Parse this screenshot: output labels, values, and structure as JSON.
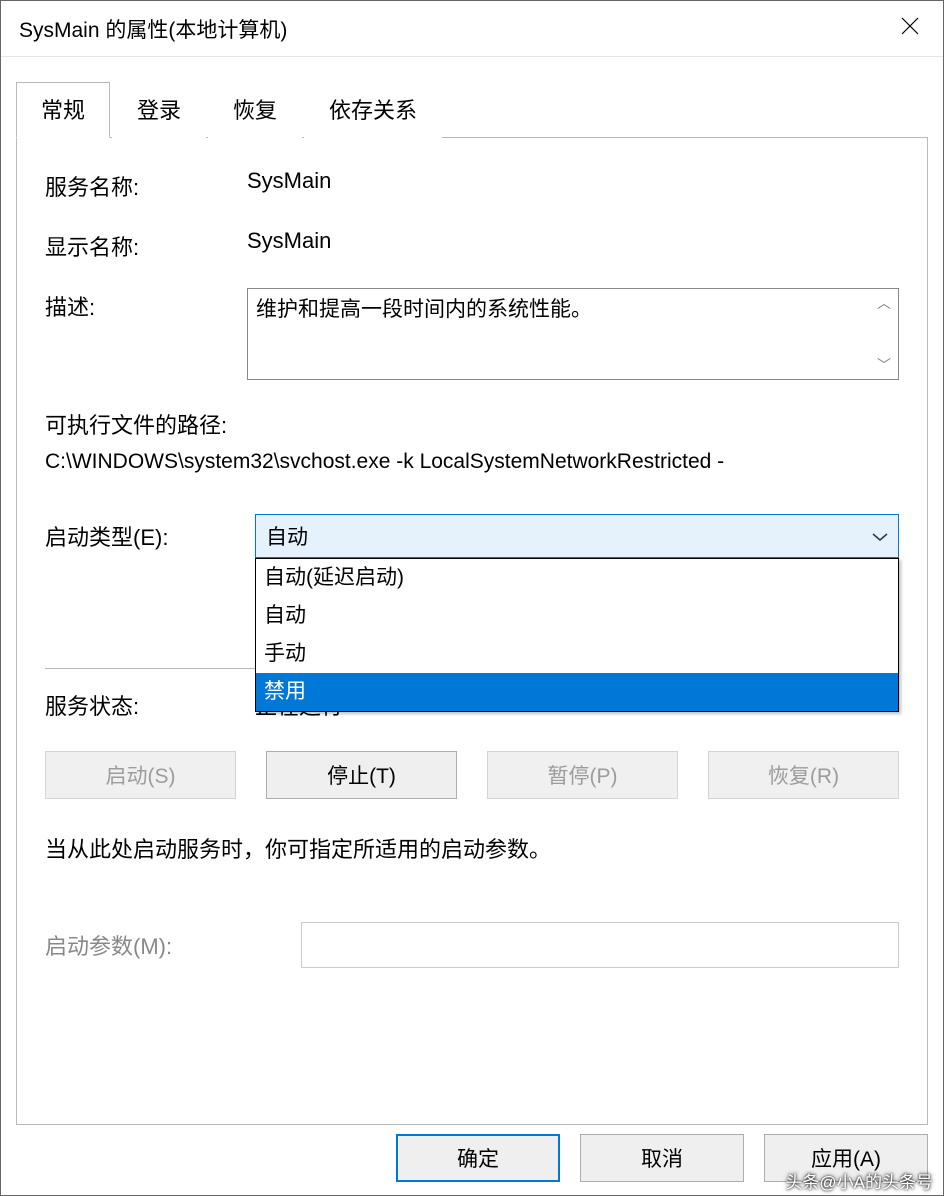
{
  "title": "SysMain 的属性(本地计算机)",
  "tabs": {
    "general": "常规",
    "logon": "登录",
    "recovery": "恢复",
    "dependencies": "依存关系"
  },
  "labels": {
    "service_name": "服务名称:",
    "display_name": "显示名称:",
    "description": "描述:",
    "exe_label": "可执行文件的路径:",
    "startup_type": "启动类型(E):",
    "service_status": "服务状态:",
    "start_params": "启动参数(M):",
    "note": "当从此处启动服务时，你可指定所适用的启动参数。"
  },
  "values": {
    "service_name": "SysMain",
    "display_name": "SysMain",
    "description": "维护和提高一段时间内的系统性能。",
    "exe_path": "C:\\WINDOWS\\system32\\svchost.exe -k LocalSystemNetworkRestricted -",
    "startup_selected": "自动",
    "service_status": "正在运行",
    "start_params": ""
  },
  "startup_options": {
    "auto_delayed": "自动(延迟启动)",
    "auto": "自动",
    "manual": "手动",
    "disabled": "禁用"
  },
  "svc_buttons": {
    "start": "启动(S)",
    "stop": "停止(T)",
    "pause": "暂停(P)",
    "resume": "恢复(R)"
  },
  "footer": {
    "ok": "确定",
    "cancel": "取消",
    "apply": "应用(A)"
  },
  "watermark": "头条@小A的头条号"
}
